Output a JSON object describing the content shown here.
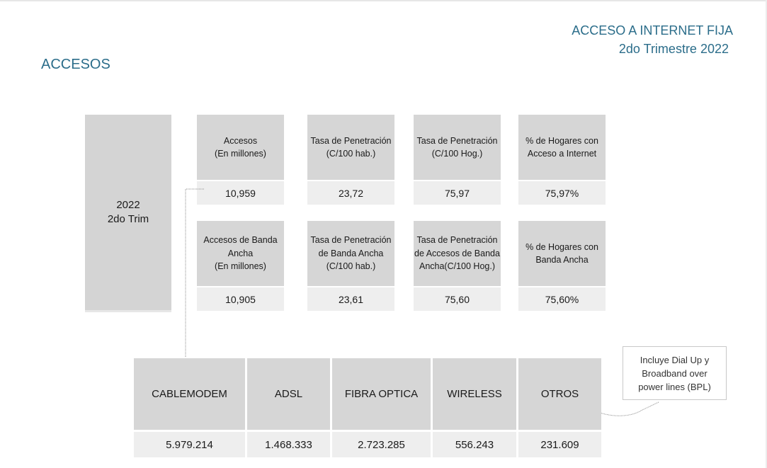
{
  "header": {
    "title": "ACCESO A INTERNET FIJA",
    "subtitle": "2do Trimestre 2022"
  },
  "section_title": "ACCESOS",
  "period": {
    "year": "2022",
    "quarter": "2do Trim"
  },
  "indicators_row1": [
    {
      "label": "Accesos\n(En millones)",
      "value": "10,959"
    },
    {
      "label": "Tasa de Penetración\n(C/100 hab.)",
      "value": "23,72"
    },
    {
      "label": "Tasa de Penetración\n(C/100 Hog.)",
      "value": "75,97"
    },
    {
      "label": "% de Hogares con\nAcceso a Internet",
      "value": "75,97%"
    }
  ],
  "indicators_row2": [
    {
      "label": "Accesos de Banda\nAncha\n(En millones)",
      "value": "10,905"
    },
    {
      "label": "Tasa de Penetración\nde Banda Ancha\n(C/100 hab.)",
      "value": "23,61"
    },
    {
      "label": "Tasa de Penetración\nde Accesos de Banda\nAncha(C/100 Hog.)",
      "value": "75,60"
    },
    {
      "label": "% de Hogares con\nBanda Ancha",
      "value": "75,60%"
    }
  ],
  "technologies": [
    {
      "name": "CABLEMODEM",
      "value": "5.979.214"
    },
    {
      "name": "ADSL",
      "value": "1.468.333"
    },
    {
      "name": "FIBRA OPTICA",
      "value": "2.723.285"
    },
    {
      "name": "WIRELESS",
      "value": "556.243"
    },
    {
      "name": "OTROS",
      "value": "231.609"
    }
  ],
  "note": "Incluye Dial Up y\nBroadband over\npower lines (BPL)",
  "colors": {
    "accent": "#2b6d8a",
    "card_header": "#d6d6d6",
    "card_value": "#eeeeee"
  }
}
